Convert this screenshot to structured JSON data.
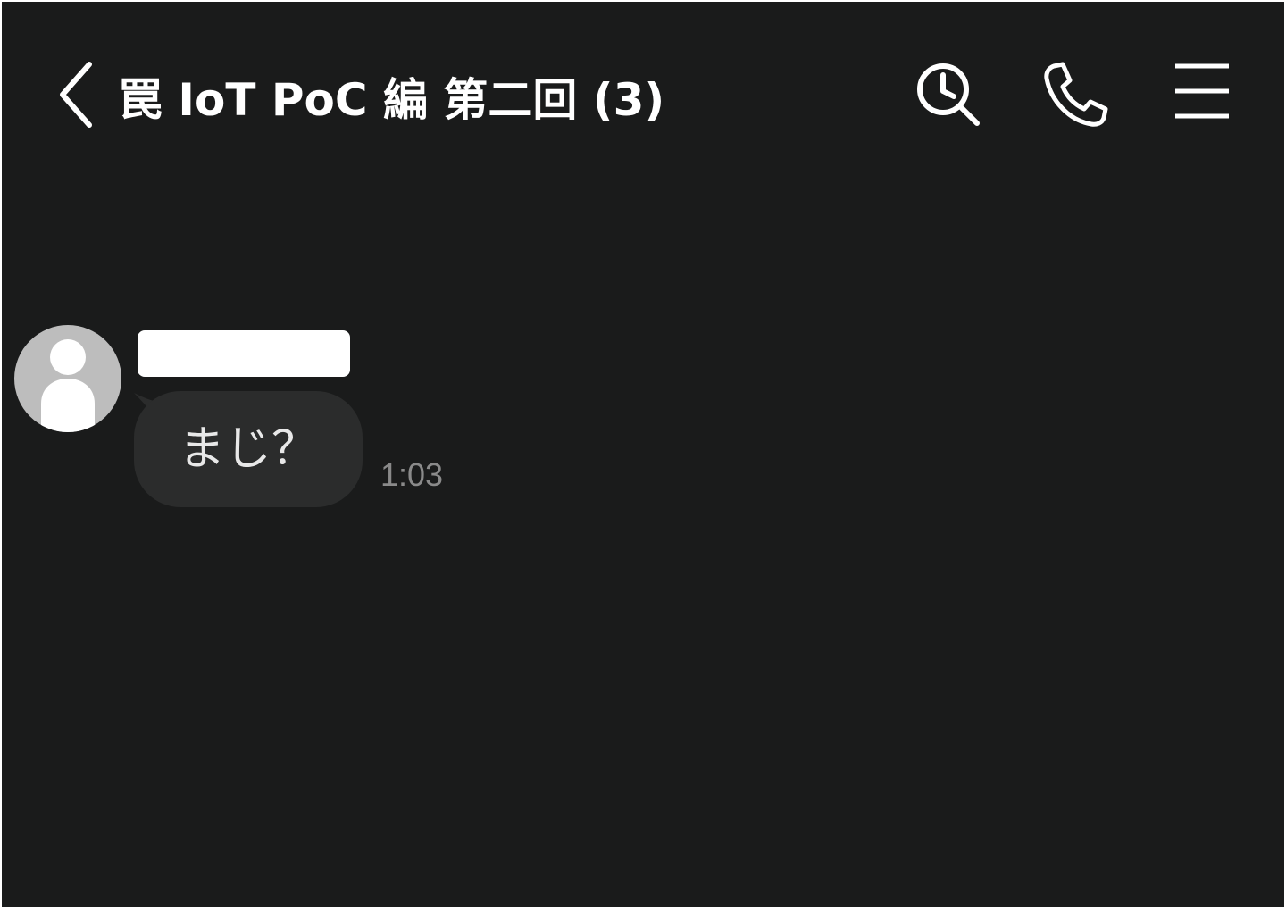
{
  "header": {
    "title": "罠 IoT PoC 編 第二回 (3)",
    "back_icon": "chevron-left-icon",
    "actions": [
      {
        "name": "search-history",
        "icon": "clock-search-icon"
      },
      {
        "name": "call",
        "icon": "phone-icon"
      },
      {
        "name": "menu",
        "icon": "hamburger-menu-icon"
      }
    ]
  },
  "conversation": {
    "messages": [
      {
        "sender": "",
        "avatar_icon": "default-person-icon",
        "text": "まじ？",
        "time": "1:03"
      }
    ]
  },
  "colors": {
    "background": "#1a1b1b",
    "bubble": "#2b2c2c",
    "avatar": "#bdbdbd",
    "timestamp": "#8a8a8a"
  }
}
